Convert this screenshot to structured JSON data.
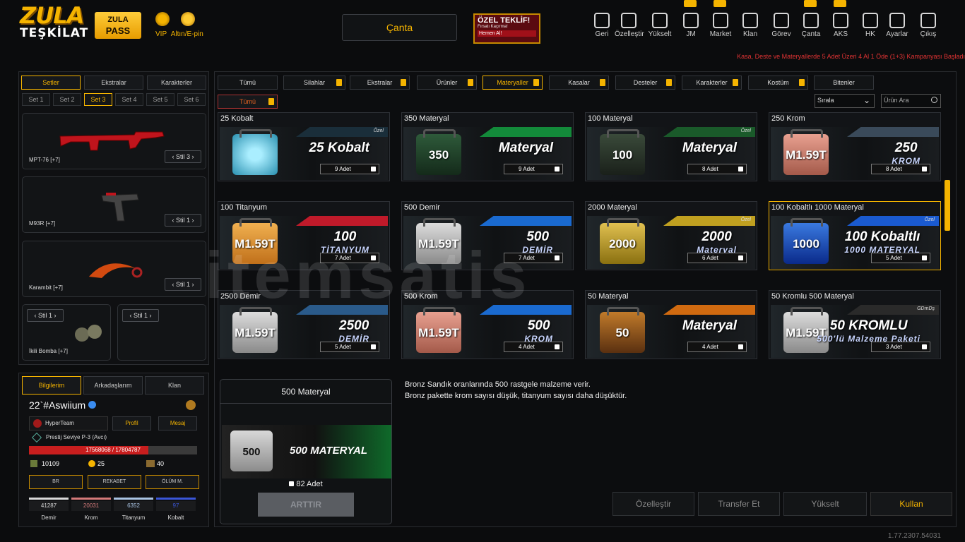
{
  "brand": {
    "logo_top": "ZULA",
    "logo_bottom": "TEŞKİLAT",
    "pass_line1": "ZULA",
    "pass_line2": "PASS",
    "vip_label": "VIP",
    "gold_label": "Altın/E-pin"
  },
  "center_title": "Çanta",
  "offer": {
    "title": "ÖZEL TEKLİF!",
    "subtitle": "Fırsatı Kaçırma!",
    "cta": "Hemen Al!"
  },
  "topnav": [
    {
      "label": "Geri",
      "icon": "back-icon"
    },
    {
      "label": "Özelleştir",
      "icon": "tools-icon"
    },
    {
      "label": "Yükselt",
      "icon": "upgrade-icon"
    },
    {
      "label": "JM",
      "icon": "coins-icon"
    },
    {
      "label": "Market",
      "icon": "cart-icon"
    },
    {
      "label": "Klan",
      "icon": "users-icon"
    },
    {
      "label": "Görev",
      "icon": "task-icon"
    },
    {
      "label": "Çanta",
      "icon": "bag-icon"
    },
    {
      "label": "AKS",
      "icon": "crosshair-icon"
    },
    {
      "label": "HK",
      "icon": "wallet-icon"
    },
    {
      "label": "Ayarlar",
      "icon": "gear-icon"
    },
    {
      "label": "Çıkış",
      "icon": "power-icon"
    }
  ],
  "promo": "Kasa, Deste ve Materyallerde 5 Adet Üzeri 4 Al 1 Öde (1+3) Kampanyası Başladı",
  "left": {
    "tabs": [
      "Setler",
      "Ekstralar",
      "Karakterler"
    ],
    "sets": [
      "Set 1",
      "Set 2",
      "Set 3",
      "Set 4",
      "Set 5",
      "Set 6"
    ],
    "weapons": [
      {
        "name": "MPT-76 [+7]",
        "style": "Stil 3"
      },
      {
        "name": "M93R [+7]",
        "style": "Stil 1"
      },
      {
        "name": "Karambit [+7]",
        "style": "Stil 1"
      },
      {
        "name": "İkili Bomba [+7]",
        "style": "Stil 1"
      },
      {
        "name": "",
        "style": "Stil 1"
      }
    ]
  },
  "categories": [
    "Tümü",
    "Silahlar",
    "Ekstralar",
    "Ürünler",
    "Materyaller",
    "Kasalar",
    "Desteler",
    "Karakterler",
    "Kostüm",
    "Bitenler"
  ],
  "subcategory": "Tümü",
  "sort_label": "Sırala",
  "search_placeholder": "Ürün Ara",
  "items": [
    {
      "name": "25 Kobalt",
      "qty": "9 Adet",
      "big": "25 Kobalt",
      "small": "",
      "tag": "Özel"
    },
    {
      "name": "350 Materyal",
      "qty": "9 Adet",
      "big": "Materyal",
      "small": "",
      "case": "350",
      "tag": ""
    },
    {
      "name": "100 Materyal",
      "qty": "8 Adet",
      "big": "Materyal",
      "small": "",
      "case": "100",
      "tag": "Özel"
    },
    {
      "name": "250 Krom",
      "qty": "8 Adet",
      "big": "250",
      "small": "KROM",
      "case": "M1.59T",
      "tag": ""
    },
    {
      "name": "100 Titanyum",
      "qty": "7 Adet",
      "big": "100",
      "small": "TİTANYUM",
      "case": "M1.59T",
      "tag": ""
    },
    {
      "name": "500 Demir",
      "qty": "7 Adet",
      "big": "500",
      "small": "DEMİR",
      "case": "M1.59T",
      "tag": ""
    },
    {
      "name": "2000 Materyal",
      "qty": "6 Adet",
      "big": "2000",
      "small": "Materyal",
      "case": "2000",
      "tag": "Özel"
    },
    {
      "name": "100 Kobaltlı 1000 Materyal",
      "qty": "5 Adet",
      "big": "100 Kobaltlı",
      "small": "1000 MATERYAL",
      "case": "1000",
      "tag": "Özel"
    },
    {
      "name": "2500 Demir",
      "qty": "5 Adet",
      "big": "2500",
      "small": "DEMİR",
      "case": "M1.59T",
      "tag": ""
    },
    {
      "name": "500 Krom",
      "qty": "4 Adet",
      "big": "500",
      "small": "KROM",
      "case": "M1.59T",
      "tag": ""
    },
    {
      "name": "50 Materyal",
      "qty": "4 Adet",
      "big": "Materyal",
      "small": "",
      "case": "50",
      "tag": ""
    },
    {
      "name": "50 Kromlu 500 Materyal",
      "qty": "3 Adet",
      "big": "50 KROMLU",
      "small": "500'lü Malzeme Paketi",
      "case": "M1.59T",
      "tag": "GDmDş"
    }
  ],
  "detail": {
    "title": "500 Materyal",
    "banner": "500 MATERYAL",
    "case": "500",
    "qty": "82 Adet",
    "button": "ARTTIR"
  },
  "description": [
    "Bronz Sandık oranlarında 500 rastgele malzeme verir.",
    "Bronz pakette krom sayısı düşük, titanyum sayısı daha düşüktür."
  ],
  "actions": [
    "Özelleştir",
    "Transfer Et",
    "Yükselt",
    "Kullan"
  ],
  "user": {
    "tabs": [
      "Bilgilerim",
      "Arkadaşlarım",
      "Klan"
    ],
    "name": "22`#Aswiium",
    "team": "HyperTeam",
    "profile": "Profil",
    "message": "Mesaj",
    "rank": "Prestij Seviye P-3 (Avcı)",
    "xp": "17568068 / 17804787",
    "xp_fraction": 0.987,
    "stats": [
      "10109",
      "25",
      "40"
    ],
    "modes": [
      "BR",
      "REKABET",
      "ÖLÜM M."
    ],
    "materials": [
      {
        "value": "41287",
        "label": "Demir",
        "color": "#d9d9d9"
      },
      {
        "value": "20031",
        "label": "Krom",
        "color": "#d47a7a"
      },
      {
        "value": "6352",
        "label": "Titanyum",
        "color": "#a9c3e3"
      },
      {
        "value": "97",
        "label": "Kobalt",
        "color": "#3a56d8"
      }
    ]
  },
  "version": "1.77.2307.54031",
  "watermark": "itemsatis"
}
